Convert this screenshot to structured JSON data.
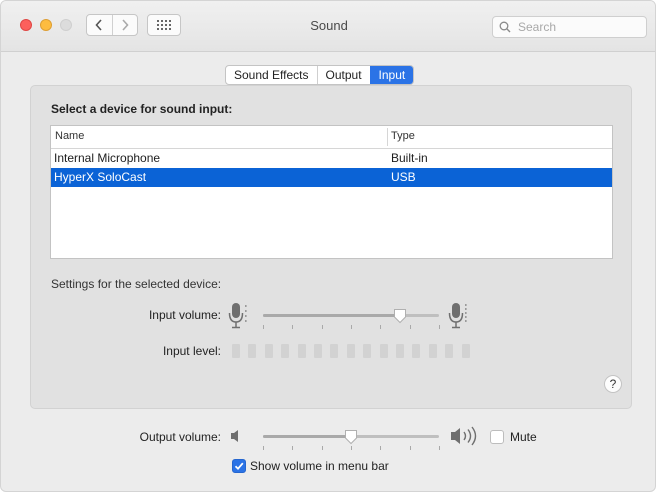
{
  "window": {
    "title": "Sound"
  },
  "toolbar": {
    "search_placeholder": "Search"
  },
  "tabs": [
    {
      "label": "Sound Effects",
      "active": false
    },
    {
      "label": "Output",
      "active": false
    },
    {
      "label": "Input",
      "active": true
    }
  ],
  "input": {
    "heading": "Select a device for sound input:",
    "table": {
      "columns": [
        "Name",
        "Type"
      ],
      "rows": [
        {
          "name": "Internal Microphone",
          "type": "Built-in",
          "selected": false
        },
        {
          "name": "HyperX SoloCast",
          "type": "USB",
          "selected": true
        }
      ]
    },
    "settings_label": "Settings for the selected device:",
    "volume_label": "Input volume:",
    "volume_level": 0.78,
    "level_label": "Input level:",
    "level_segments_lit": 0,
    "level_segments_total": 15
  },
  "output": {
    "volume_label": "Output volume:",
    "volume_level": 0.5,
    "mute_label": "Mute",
    "mute_checked": false,
    "show_menu_bar_label": "Show volume in menu bar",
    "show_menu_bar_checked": true
  },
  "colors": {
    "accent": "#2b73e6",
    "selection": "#0b63d6",
    "close": "#fc605c",
    "minimize": "#fdbc40"
  },
  "icons": {
    "back": "chevron-left-icon",
    "forward": "chevron-right-icon",
    "grid": "grid-icon",
    "search": "magnifier-icon",
    "mic": "microphone-icon",
    "speaker_low": "speaker-low-icon",
    "speaker_high": "speaker-high-icon",
    "help": "question-mark-icon"
  },
  "help": {
    "label": "?"
  }
}
